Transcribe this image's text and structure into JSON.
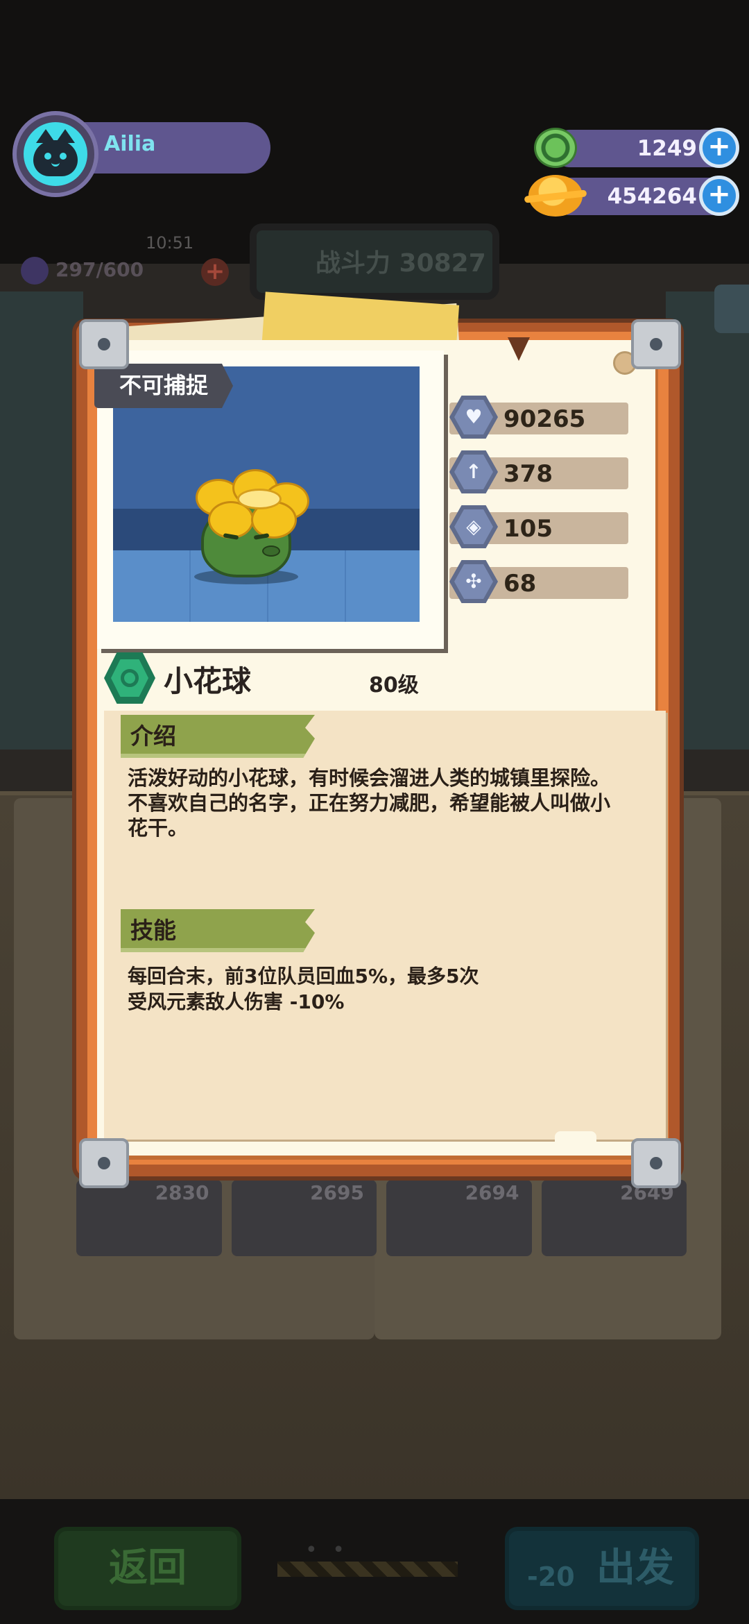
{
  "header": {
    "username": "Ailia",
    "currency_gems": "1249",
    "currency_coins": "454264",
    "plus_label": "+"
  },
  "background": {
    "stamina": "297/600",
    "clock": "10:51",
    "power_text": "战斗力 30827",
    "card_powers": [
      "2830",
      "2695",
      "2694",
      "2649"
    ],
    "return_label": "返回",
    "depart_label": "出发",
    "depart_cost": "-20",
    "page_dots": "• •"
  },
  "card": {
    "capture_badge": "不可捕捉",
    "stats": {
      "hp": "90265",
      "attack": "378",
      "defense": "105",
      "speed": "68"
    },
    "name": "小花球",
    "level": "80级",
    "intro_title": "介绍",
    "intro_text": "活泼好动的小花球，有时候会溜进人类的城镇里探险。不喜欢自己的名字，正在努力减肥，希望能被人叫做小花干。",
    "skill_title": "技能",
    "skill_lines": [
      "每回合末，前3位队员回血5%，最多5次",
      "受风元素敌人伤害 -10%"
    ]
  },
  "icons": {
    "hp": "heart-icon",
    "attack": "sword-icon",
    "defense": "shield-icon",
    "speed": "wing-speed-icon",
    "element": "grass-element-icon"
  },
  "colors": {
    "accent_purple": "#5f568f",
    "avatar_cyan": "#3edbe8",
    "plus_blue": "#2f8fe0",
    "section_green": "#8fa34c",
    "card_orange": "#e8823f"
  }
}
